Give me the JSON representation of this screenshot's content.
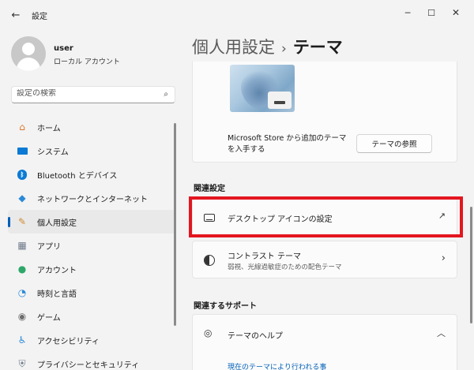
{
  "window": {
    "title": "設定"
  },
  "user": {
    "name": "user",
    "account_type": "ローカル アカウント"
  },
  "search": {
    "placeholder": "設定の検索"
  },
  "nav": {
    "items": [
      {
        "label": "ホーム",
        "icon": "home-icon",
        "color": "#e0762b"
      },
      {
        "label": "システム",
        "icon": "system-icon",
        "color": "#0a7ad4"
      },
      {
        "label": "Bluetooth とデバイス",
        "icon": "bluetooth-icon",
        "color": "#0a7ad4"
      },
      {
        "label": "ネットワークとインターネット",
        "icon": "wifi-icon",
        "color": "#2b8ad8"
      },
      {
        "label": "個人用設定",
        "icon": "brush-icon",
        "color": "#d08a35",
        "active": true
      },
      {
        "label": "アプリ",
        "icon": "apps-icon",
        "color": "#6d7a8a"
      },
      {
        "label": "アカウント",
        "icon": "account-icon",
        "color": "#2ea86a"
      },
      {
        "label": "時刻と言語",
        "icon": "globe-clock-icon",
        "color": "#2b8ad8"
      },
      {
        "label": "ゲーム",
        "icon": "gamepad-icon",
        "color": "#6d6d6d"
      },
      {
        "label": "アクセシビリティ",
        "icon": "accessibility-icon",
        "color": "#2b8ad8"
      },
      {
        "label": "プライバシーとセキュリティ",
        "icon": "shield-icon",
        "color": "#6d7a8a"
      }
    ]
  },
  "breadcrumb": {
    "parent": "個人用設定",
    "separator": "›",
    "current": "テーマ"
  },
  "theme_card": {
    "store_text_line1": "Microsoft Store から追加のテーマ",
    "store_text_line2": "を入手する",
    "browse_button": "テーマの参照"
  },
  "related": {
    "title": "関連設定",
    "desktop_icons": {
      "label": "デスクトップ アイコンの設定"
    },
    "contrast": {
      "label": "コントラスト テーマ",
      "sub": "弱視、光線過敏症のための配色テーマ"
    }
  },
  "support": {
    "title": "関連するサポート",
    "help": {
      "label": "テーマのヘルプ"
    },
    "cutoff_link": "現在のテーマにより行われる事"
  },
  "colors": {
    "accent": "#005fb8",
    "highlight": "#e3161f"
  }
}
